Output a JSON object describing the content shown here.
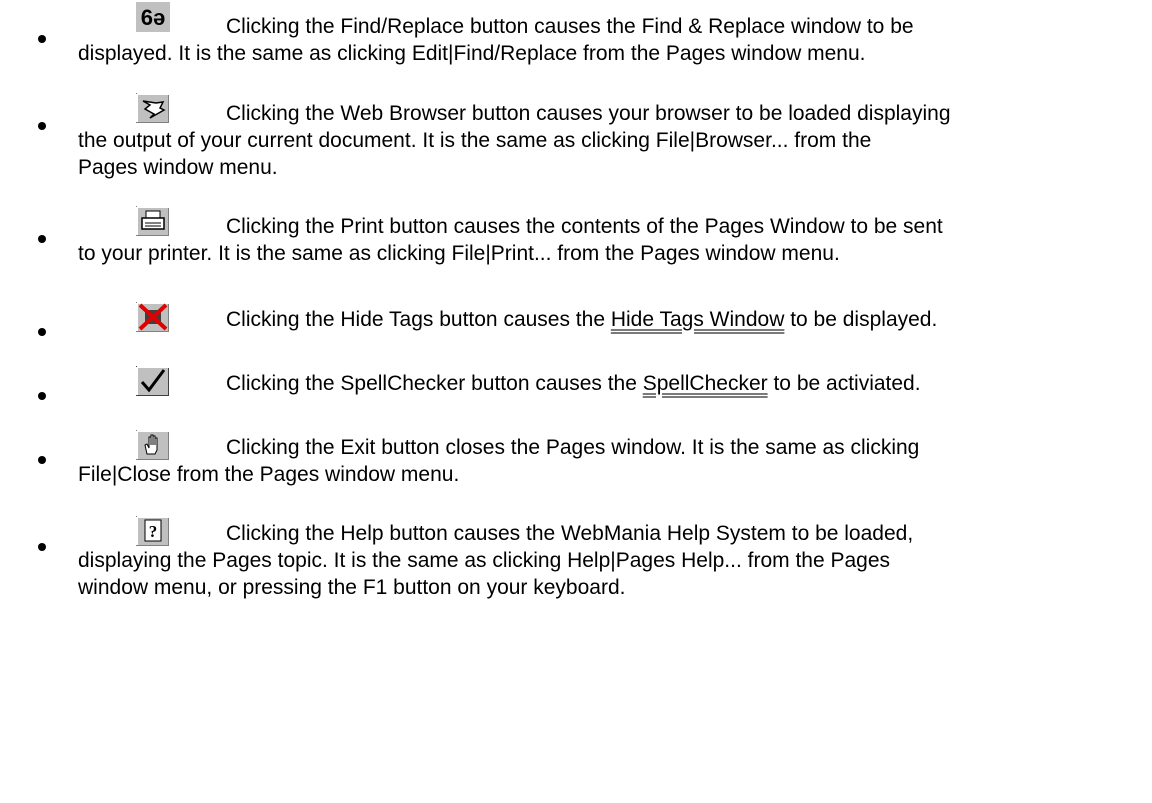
{
  "items": [
    {
      "icon": "glasses-icon",
      "lines": [
        "Clicking the Find/Replace button causes the Find & Replace window to be",
        "displayed.   It is the same as clicking Edit|Find/Replace from the Pages window menu."
      ]
    },
    {
      "icon": "web-browser-icon",
      "lines": [
        "Clicking the Web Browser button causes your browser to be loaded displaying",
        "the output of your current document.   It is the same as clicking File|Browser... from the",
        "Pages window menu."
      ]
    },
    {
      "icon": "printer-icon",
      "lines": [
        "Clicking the Print button causes the contents of the Pages Window to be sent",
        "to your printer.   It is the same as clicking File|Print... from the Pages window menu."
      ]
    },
    {
      "icon": "hide-tags-icon",
      "prefix": "Clicking the Hide Tags button causes the ",
      "link": "Hide Tags Window",
      "suffix": " to be displayed."
    },
    {
      "icon": "checkmark-icon",
      "prefix": "Clicking the SpellChecker button causes the ",
      "link": "SpellChecker",
      "suffix": " to be activiated."
    },
    {
      "icon": "hand-icon",
      "lines": [
        "Clicking the Exit button closes the Pages window.   It is the same as clicking",
        "File|Close from the Pages window menu."
      ]
    },
    {
      "icon": "help-question-icon",
      "lines": [
        "Clicking the Help button causes the WebMania Help System to be loaded,",
        "displaying the Pages topic.   It is the same as clicking Help|Pages Help... from the Pages",
        "window menu, or pressing the F1 button on your keyboard."
      ]
    }
  ]
}
